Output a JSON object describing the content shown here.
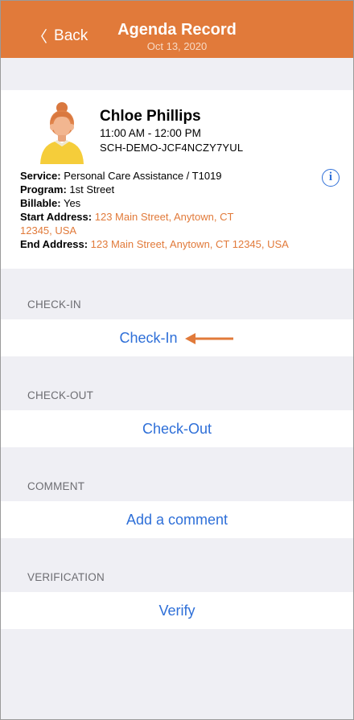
{
  "nav": {
    "back_label": "Back",
    "title": "Agenda Record",
    "date": "Oct 13, 2020"
  },
  "client": {
    "name": "Chloe Phillips",
    "time": "11:00 AM - 12:00 PM",
    "code": "SCH-DEMO-JCF4NCZY7YUL"
  },
  "details": {
    "service_label": "Service:",
    "service_value": "Personal Care Assistance / T1019",
    "program_label": "Program:",
    "program_value": "1st Street",
    "billable_label": "Billable:",
    "billable_value": "Yes",
    "start_label": "Start Address:",
    "start_value_line1": "123 Main Street, Anytown, CT",
    "start_value_line2": "12345, USA",
    "end_label": "End Address:",
    "end_value": "123 Main Street, Anytown, CT 12345, USA"
  },
  "sections": {
    "checkin_header": "CHECK-IN",
    "checkin_action": "Check-In",
    "checkout_header": "CHECK-OUT",
    "checkout_action": "Check-Out",
    "comment_header": "COMMENT",
    "comment_action": "Add a comment",
    "verification_header": "VERIFICATION",
    "verification_action": "Verify"
  },
  "icons": {
    "info": "i"
  },
  "colors": {
    "accent": "#e17a3a",
    "link": "#2e6fd8",
    "background": "#efeff4"
  }
}
